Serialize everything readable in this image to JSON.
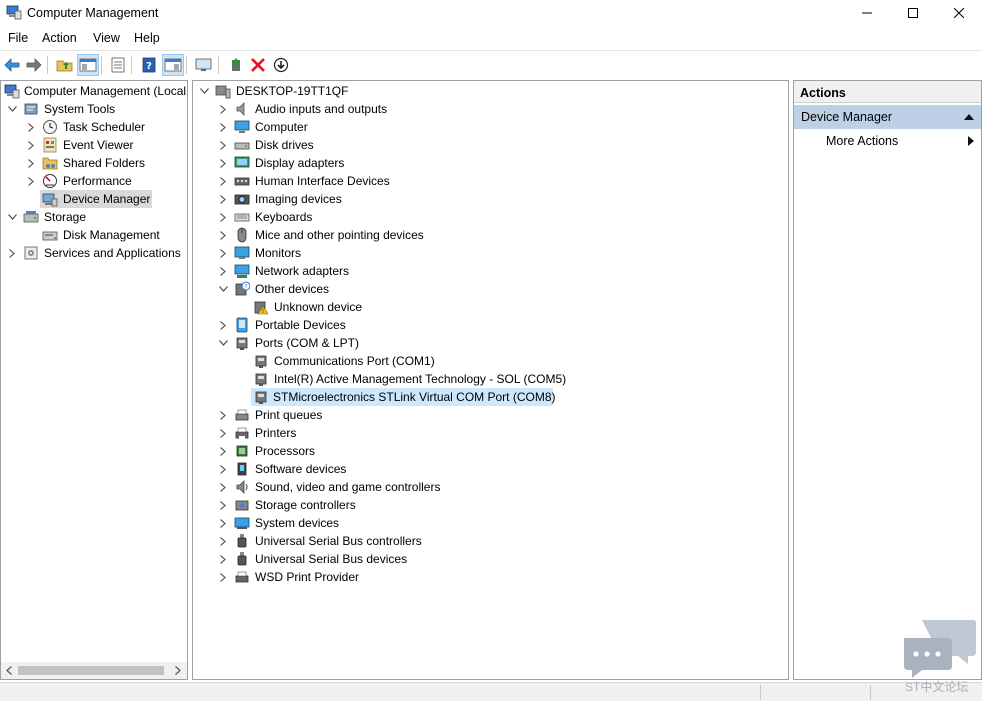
{
  "window": {
    "title": "Computer Management",
    "minimize_glyph": "—",
    "maximize_glyph": "☐",
    "close_glyph": "✕"
  },
  "menu": [
    "File",
    "Action",
    "View",
    "Help"
  ],
  "toolbar_icons": [
    "back-arrow-icon",
    "forward-arrow-icon",
    "up-folder-icon",
    "show-hide-tree-icon",
    "properties-icon",
    "help-icon",
    "console-view-icon",
    "monitor-icon",
    "update-driver-icon",
    "uninstall-icon",
    "disable-device-icon"
  ],
  "left_tree": {
    "root": "Computer Management (Local",
    "system_tools": "System Tools",
    "task_scheduler": "Task Scheduler",
    "event_viewer": "Event Viewer",
    "shared_folders": "Shared Folders",
    "performance": "Performance",
    "device_manager": "Device Manager",
    "storage": "Storage",
    "disk_management": "Disk Management",
    "services_apps": "Services and Applications"
  },
  "device_tree": {
    "computer_name": "DESKTOP-19TT1QF",
    "categories": [
      "Audio inputs and outputs",
      "Computer",
      "Disk drives",
      "Display adapters",
      "Human Interface Devices",
      "Imaging devices",
      "Keyboards",
      "Mice and other pointing devices",
      "Monitors",
      "Network adapters",
      "Other devices",
      "Portable Devices",
      "Ports (COM & LPT)",
      "Print queues",
      "Printers",
      "Processors",
      "Software devices",
      "Sound, video and game controllers",
      "Storage controllers",
      "System devices",
      "Universal Serial Bus controllers",
      "Universal Serial Bus devices",
      "WSD Print Provider"
    ],
    "other_devices_children": [
      "Unknown device"
    ],
    "ports_children": [
      "Communications Port (COM1)",
      "Intel(R) Active Management Technology - SOL (COM5)",
      "STMicroelectronics STLink Virtual COM Port (COM8)"
    ],
    "selected_item": "STMicroelectronics STLink Virtual COM Port (COM8)"
  },
  "actions": {
    "header": "Actions",
    "section": "Device Manager",
    "more_actions": "More Actions"
  },
  "watermark": "ST中文论坛",
  "colors": {
    "selected_blue": "#cce8ff",
    "selected_gray": "#d9d9d9",
    "actions_section": "#bdd0e6",
    "uninstall_red": "#e81123"
  }
}
